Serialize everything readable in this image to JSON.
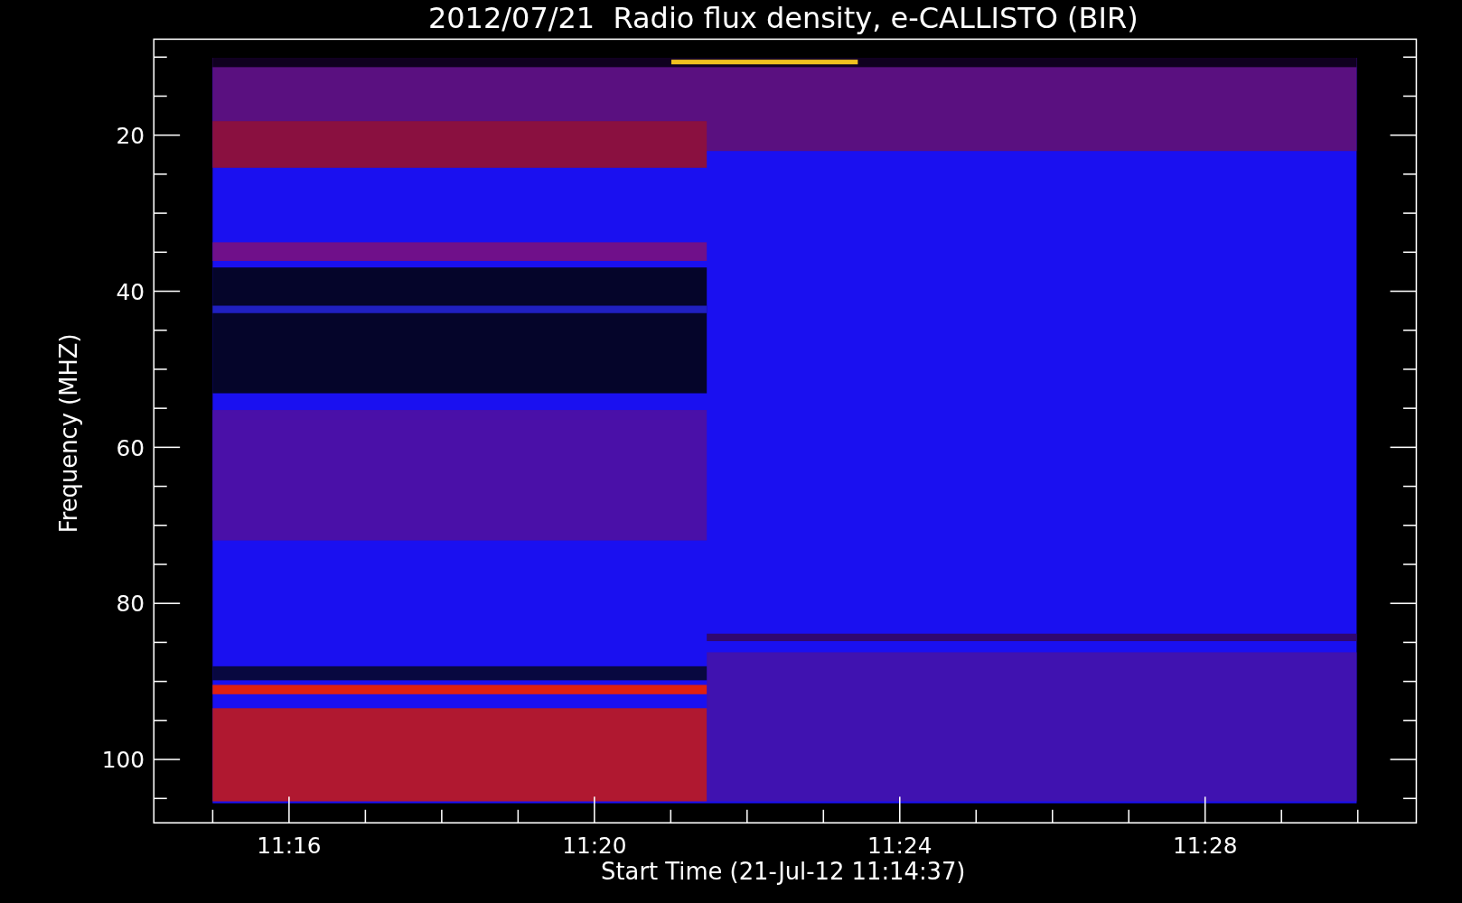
{
  "title": "2012/07/21  Radio flux density, e-CALLISTO (BIR)",
  "y_axis": {
    "label": "Frequency (MHZ)",
    "ticks": [
      "20",
      "40",
      "60",
      "80",
      "100"
    ]
  },
  "x_axis": {
    "label": "Start Time (21-Jul-12 11:14:37)",
    "ticks": [
      "11:16",
      "11:20",
      "11:24",
      "11:28"
    ]
  }
}
